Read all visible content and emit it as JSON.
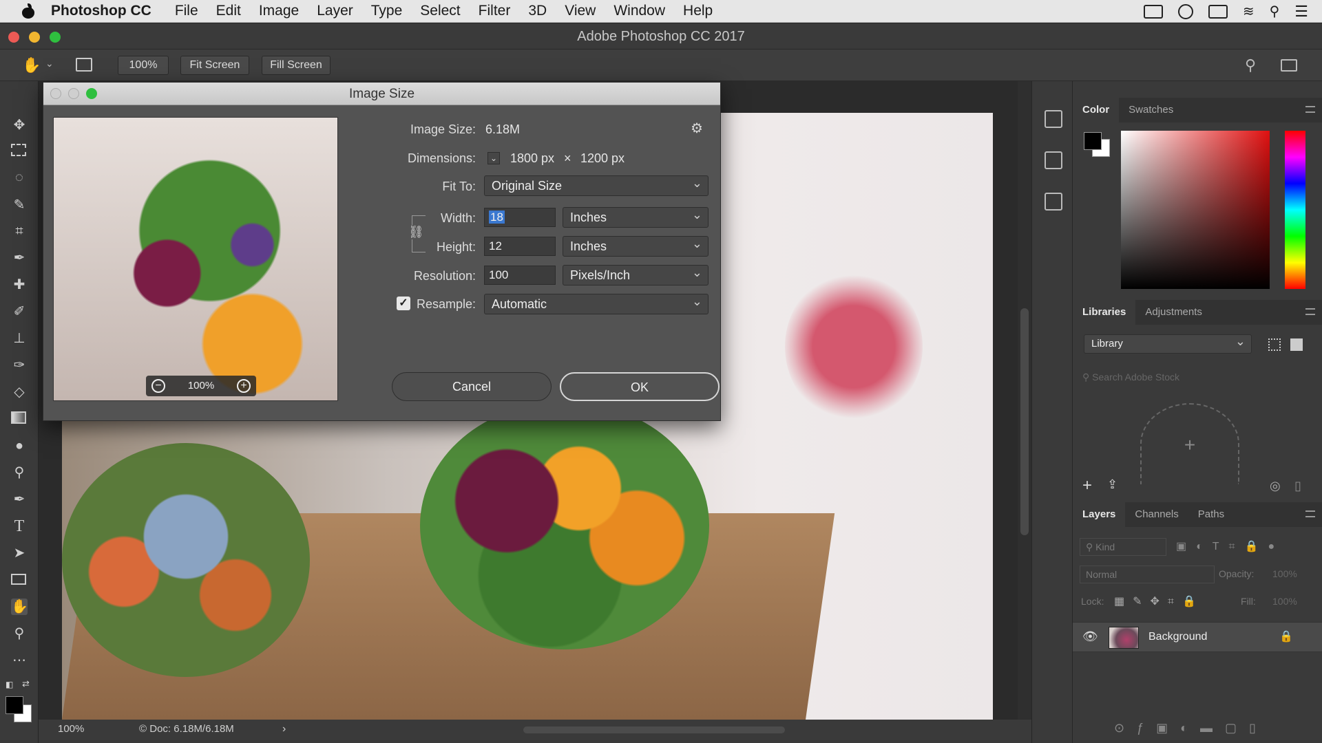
{
  "menubar": {
    "app_name": "Photoshop CC",
    "items": [
      "File",
      "Edit",
      "Image",
      "Layer",
      "Type",
      "Select",
      "Filter",
      "3D",
      "View",
      "Window",
      "Help"
    ]
  },
  "window": {
    "title": "Adobe Photoshop CC 2017"
  },
  "options_bar": {
    "zoom": "100%",
    "fit_screen": "Fit Screen",
    "fill_screen": "Fill Screen"
  },
  "dialog": {
    "title": "Image Size",
    "preview_zoom": "100%",
    "image_size_label": "Image Size:",
    "image_size_value": "6.18M",
    "dimensions_label": "Dimensions:",
    "dimensions_width": "1800 px",
    "dimensions_times": "×",
    "dimensions_height": "1200 px",
    "fit_to_label": "Fit To:",
    "fit_to_value": "Original Size",
    "width_label": "Width:",
    "width_value": "18",
    "width_unit": "Inches",
    "height_label": "Height:",
    "height_value": "12",
    "height_unit": "Inches",
    "resolution_label": "Resolution:",
    "resolution_value": "100",
    "resolution_unit": "Pixels/Inch",
    "resample_label": "Resample:",
    "resample_checked": true,
    "resample_value": "Automatic",
    "cancel_label": "Cancel",
    "ok_label": "OK"
  },
  "status": {
    "zoom": "100%",
    "doc": "Doc: 6.18M/6.18M"
  },
  "color_panel": {
    "tabs": [
      "Color",
      "Swatches"
    ]
  },
  "libraries_panel": {
    "tabs": [
      "Libraries",
      "Adjustments"
    ],
    "library_select": "Library",
    "search_placeholder": "Search Adobe Stock"
  },
  "layers_panel": {
    "tabs": [
      "Layers",
      "Channels",
      "Paths"
    ],
    "kind_placeholder": "Kind",
    "blend_mode": "Normal",
    "opacity_label": "Opacity:",
    "opacity_value": "100%",
    "lock_label": "Lock:",
    "fill_label": "Fill:",
    "fill_value": "100%",
    "layers": [
      {
        "name": "Background",
        "visible": true,
        "locked": true
      }
    ]
  }
}
